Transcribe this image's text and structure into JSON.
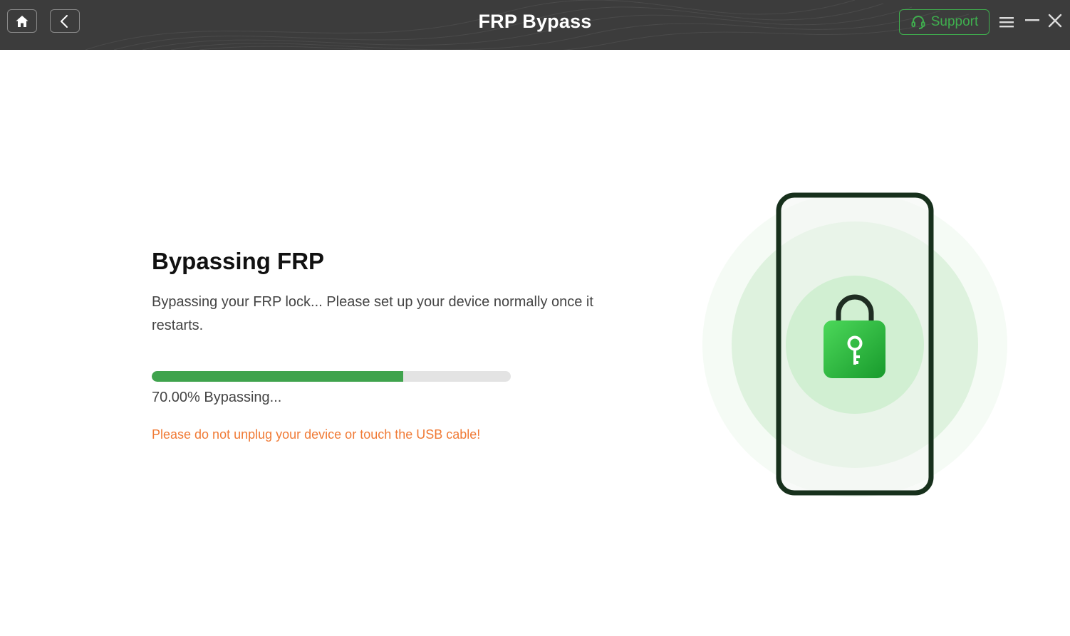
{
  "header": {
    "title": "FRP Bypass",
    "support_label": "Support",
    "icons": {
      "home": "home-icon",
      "back": "chevron-left-icon",
      "support": "headset-icon",
      "menu": "hamburger-menu-icon",
      "minimize": "minimize-icon",
      "close": "close-icon"
    }
  },
  "main": {
    "heading": "Bypassing FRP",
    "description": "Bypassing your FRP lock... Please set up your device normally once it restarts.",
    "progress": {
      "percent": 70,
      "label": "70.00% Bypassing..."
    },
    "warning": "Please do not unplug your device or touch the USB cable!"
  },
  "illustration": {
    "icon": "phone-lock-key-icon"
  },
  "colors": {
    "titlebar_bg": "#3c3c3c",
    "accent_green": "#3fae4e",
    "progress_fill": "#3fa34d",
    "warning_orange": "#f07a35"
  }
}
